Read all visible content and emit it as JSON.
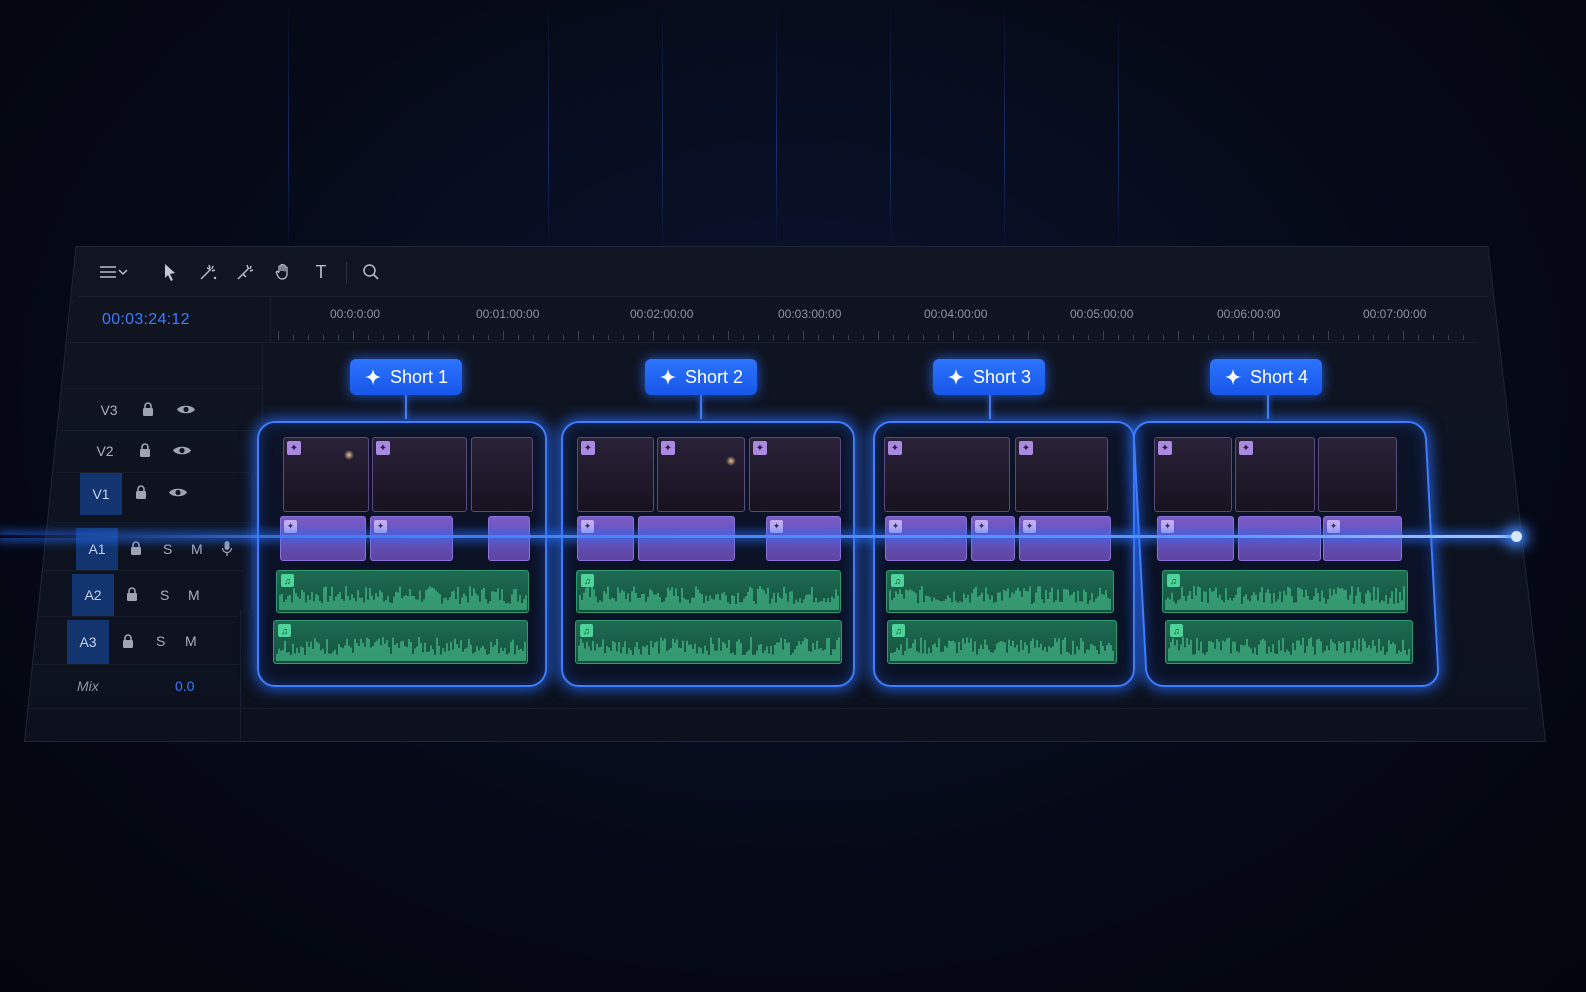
{
  "toolbar": {
    "tools": [
      {
        "icon": "menu-icon"
      },
      {
        "icon": "chevron-down-icon"
      },
      {
        "icon": "pointer-icon"
      },
      {
        "icon": "blade-icon"
      },
      {
        "icon": "magic-edit-icon"
      },
      {
        "icon": "hand-icon"
      },
      {
        "icon": "text-icon",
        "glyph": "T"
      },
      {
        "icon": "search-icon"
      }
    ]
  },
  "timeline": {
    "timecode": "00:03:24:12",
    "ruler_labels": [
      "00:0:0:00",
      "00:01:00:00",
      "00:02:00:00",
      "00:03:00:00",
      "00:04:00:00",
      "00:05:00:00",
      "00:06:00:00",
      "00:07:00:00"
    ]
  },
  "tracks": {
    "video": [
      {
        "name": "V3",
        "active": false
      },
      {
        "name": "V2",
        "active": false
      },
      {
        "name": "V1",
        "active": true
      }
    ],
    "audio": [
      {
        "name": "A1",
        "solo": "S",
        "mute": "M",
        "has_mic": true
      },
      {
        "name": "A2",
        "solo": "S",
        "mute": "M",
        "has_mic": false
      },
      {
        "name": "A3",
        "solo": "S",
        "mute": "M",
        "has_mic": false
      }
    ],
    "mix": {
      "label": "Mix",
      "value": "0.0"
    }
  },
  "shorts": [
    {
      "label": "Short 1"
    },
    {
      "label": "Short 2"
    },
    {
      "label": "Short 3"
    },
    {
      "label": "Short 4"
    }
  ],
  "colors": {
    "accent": "#3d7bff",
    "video_clip": "#6b50b8",
    "audio_clip": "#1a5e48",
    "waveform": "#4fd39a"
  }
}
